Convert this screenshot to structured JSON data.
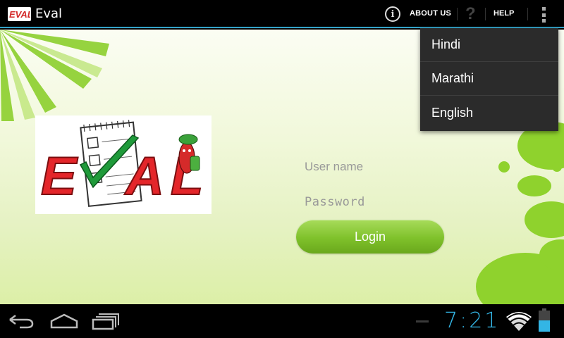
{
  "app": {
    "title": "Eval",
    "logo_text": "EVAL"
  },
  "actionbar": {
    "about_label": "ABOUT US",
    "help_label": "HELP",
    "info_icon": "info-icon",
    "help_icon": "help-icon",
    "overflow_icon": "overflow-menu-icon",
    "accent": "#33a3c8"
  },
  "language_menu": {
    "items": [
      {
        "label": "Hindi"
      },
      {
        "label": "Marathi"
      },
      {
        "label": "English"
      }
    ]
  },
  "login": {
    "username_placeholder": "User name",
    "password_placeholder": "Password",
    "login_label": "Login",
    "button_color": "#7fc12b"
  },
  "logo": {
    "text": "EVAL"
  },
  "statusbar": {
    "clock": "7:21",
    "clock_color": "#33b5e5"
  },
  "navbar": {
    "back_icon": "back-icon",
    "home_icon": "home-icon",
    "recents_icon": "recents-icon"
  }
}
